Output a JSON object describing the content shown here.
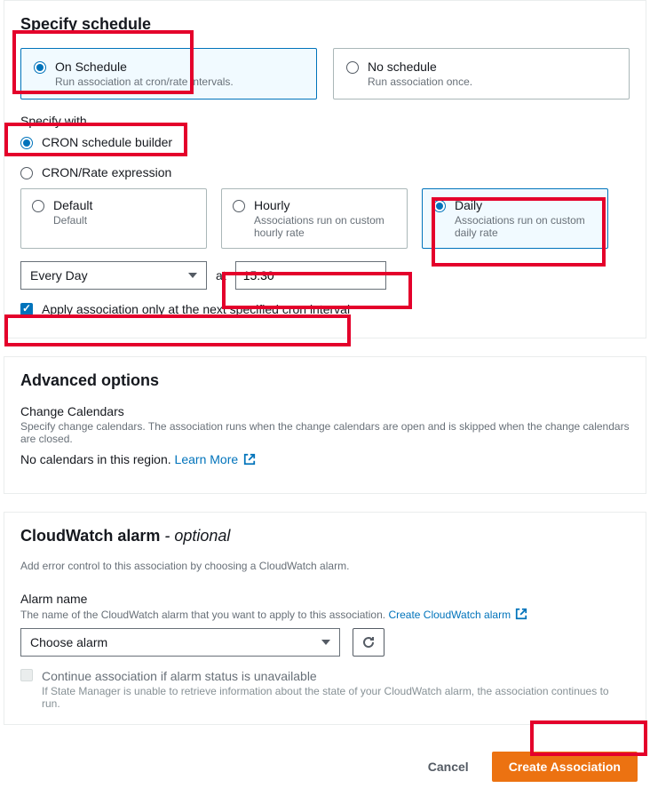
{
  "schedule": {
    "title": "Specify schedule",
    "onSchedule": {
      "label": "On Schedule",
      "desc": "Run association at cron/rate intervals."
    },
    "noSchedule": {
      "label": "No schedule",
      "desc": "Run association once."
    },
    "specifyWith": "Specify with",
    "cronBuilder": "CRON schedule builder",
    "cronRateExpr": "CRON/Rate expression",
    "default": {
      "title": "Default",
      "desc": "Default"
    },
    "hourly": {
      "title": "Hourly",
      "desc": "Associations run on custom hourly rate"
    },
    "daily": {
      "title": "Daily",
      "desc": "Associations run on custom daily rate"
    },
    "daySelect": "Every Day",
    "atLabel": "at",
    "time": "15:30",
    "applyNext": "Apply association only at the next specified cron interval"
  },
  "advanced": {
    "title": "Advanced options",
    "changeCal": "Change Calendars",
    "changeCalDesc": "Specify change calendars. The association runs when the change calendars are open and is skipped when the change calendars are closed.",
    "noCalendars": "No calendars in this region. ",
    "learnMore": "Learn More"
  },
  "alarm": {
    "title": "CloudWatch alarm",
    "optional": " - optional",
    "desc": "Add error control to this association by choosing a CloudWatch alarm.",
    "nameLabel": "Alarm name",
    "nameDesc": "The name of the CloudWatch alarm that you want to apply to this association. ",
    "createLink": "Create CloudWatch alarm",
    "choose": "Choose alarm",
    "continueLabel": "Continue association if alarm status is unavailable",
    "continueDesc": "If State Manager is unable to retrieve information about the state of your CloudWatch alarm, the association continues to run."
  },
  "footer": {
    "cancel": "Cancel",
    "create": "Create Association"
  }
}
